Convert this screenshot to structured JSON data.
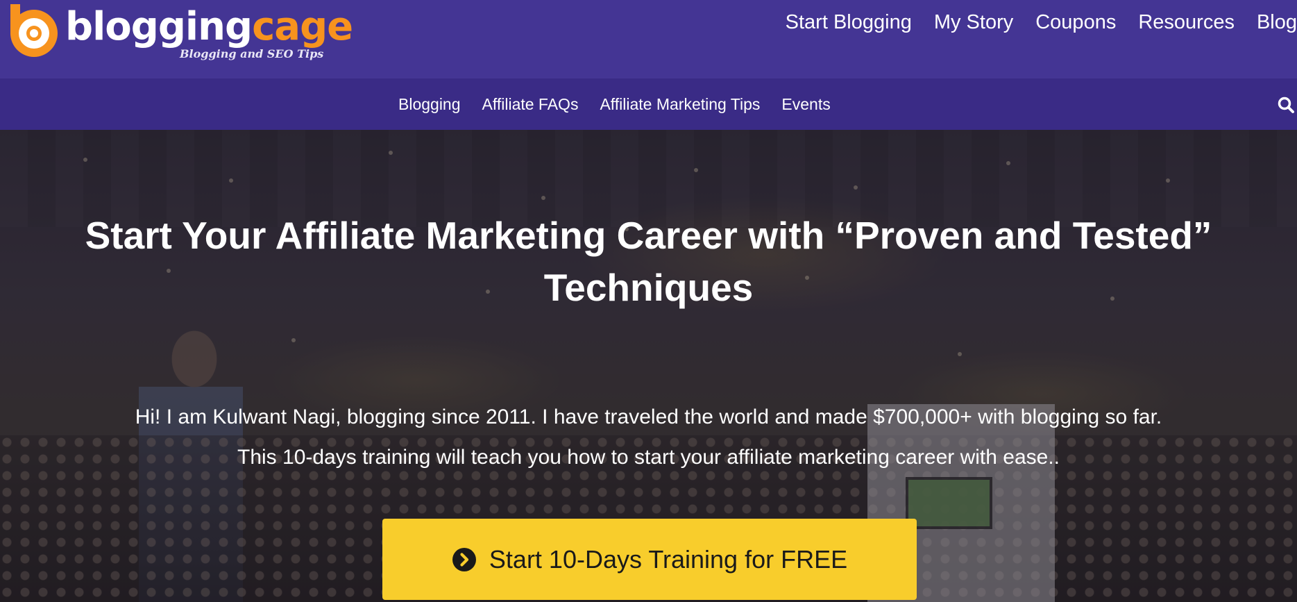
{
  "header": {
    "logo": {
      "word_part1": "blogging",
      "word_part2": "cage",
      "tagline": "Blogging and SEO Tips",
      "brand_white": "#ffffff",
      "brand_orange": "#f7931e"
    },
    "nav": [
      "Start Blogging",
      "My Story",
      "Coupons",
      "Resources",
      "Blog"
    ],
    "background": "#443594"
  },
  "subnav": {
    "items": [
      "Blogging",
      "Affiliate FAQs",
      "Affiliate Marketing Tips",
      "Events"
    ],
    "search_icon": "search-icon",
    "background": "#3a2b86"
  },
  "hero": {
    "title_line1": "Start Your Affiliate Marketing Career with “Proven and Tested”",
    "title_line2": "Techniques",
    "text_line1": "Hi! I am Kulwant Nagi, blogging since 2011. I have traveled the world and made $700,000+ with blogging so far.",
    "text_line2": "This 10-days training will teach you how to start your affiliate marketing career with ease..",
    "cta_label": "Start 10-Days Training for FREE",
    "cta_icon": "chevron-circle-right-icon",
    "cta_color": "#f8cd2c"
  }
}
